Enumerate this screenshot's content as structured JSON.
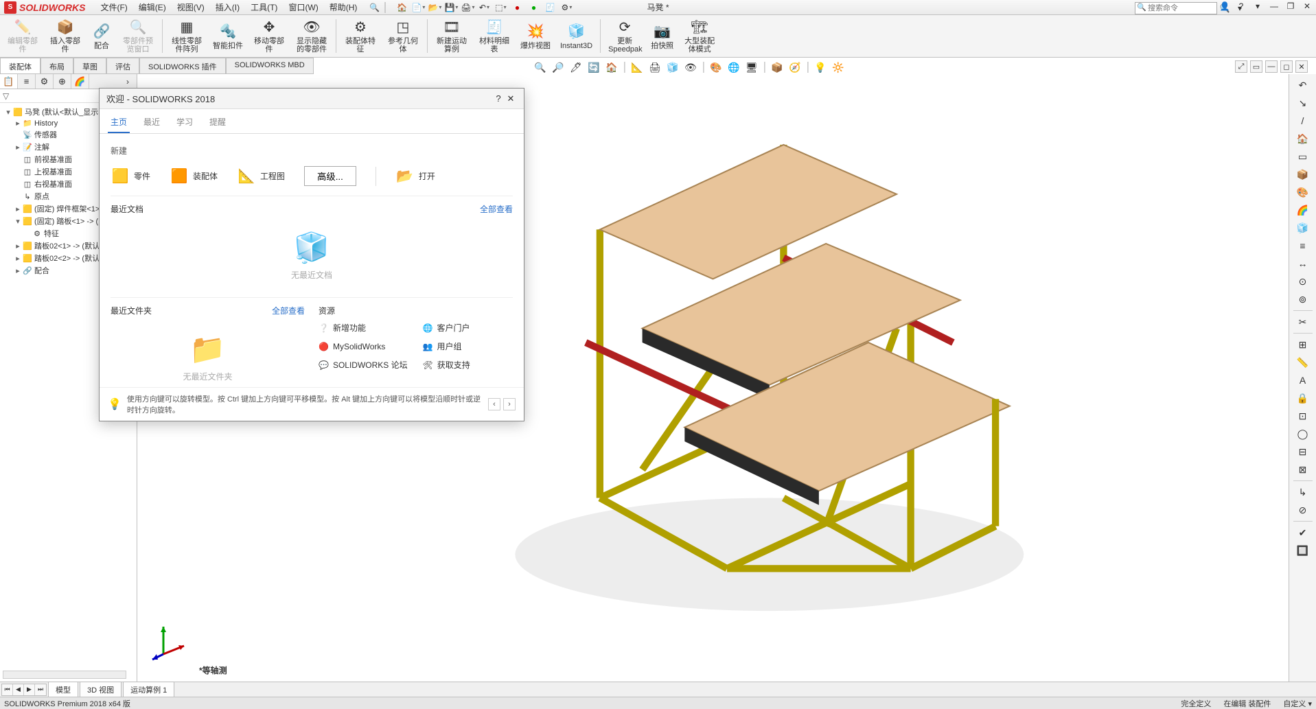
{
  "app": {
    "name": "SOLIDWORKS",
    "doc_title": "马凳 *"
  },
  "menu": [
    "文件(F)",
    "编辑(E)",
    "视图(V)",
    "插入(I)",
    "工具(T)",
    "窗口(W)",
    "帮助(H)"
  ],
  "search": {
    "placeholder": "搜索命令"
  },
  "ribbon": [
    {
      "label": "编辑零部件",
      "icon": "✏️",
      "disabled": true
    },
    {
      "label": "插入零部件",
      "icon": "📦"
    },
    {
      "label": "配合",
      "icon": "🔗"
    },
    {
      "label": "零部件预览窗口",
      "icon": "🔍",
      "disabled": true
    },
    {
      "label": "线性零部件阵列",
      "icon": "▦"
    },
    {
      "label": "智能扣件",
      "icon": "🔩"
    },
    {
      "label": "移动零部件",
      "icon": "✥"
    },
    {
      "label": "显示隐藏的零部件",
      "icon": "👁"
    },
    {
      "label": "装配体特征",
      "icon": "⚙"
    },
    {
      "label": "参考几何体",
      "icon": "◳"
    },
    {
      "label": "新建运动算例",
      "icon": "🎞"
    },
    {
      "label": "材料明细表",
      "icon": "🧾"
    },
    {
      "label": "爆炸视图",
      "icon": "💥"
    },
    {
      "label": "Instant3D",
      "icon": "🧊"
    },
    {
      "label": "更新Speedpak",
      "icon": "⟳"
    },
    {
      "label": "拍快照",
      "icon": "📷"
    },
    {
      "label": "大型装配体模式",
      "icon": "🏗"
    }
  ],
  "feature_tabs": [
    "装配体",
    "布局",
    "草图",
    "评估",
    "SOLIDWORKS 插件",
    "SOLIDWORKS MBD"
  ],
  "feature_tabs_active": 0,
  "hud": [
    "🔍",
    "🔎",
    "🖊",
    "🔄",
    "🏠",
    "📐",
    "🖨",
    "🧊",
    "👁",
    "🎨",
    "🌐",
    "🖥",
    "📦",
    "🧭",
    "💡",
    "🔆"
  ],
  "doc_win": [
    "⤢",
    "▭",
    "—",
    "◻",
    "✕"
  ],
  "fm_tabs": [
    "📋",
    "≡",
    "⚙",
    "⊕",
    "🌈"
  ],
  "fm_root": "马凳  (默认<默认_显示状态-",
  "tree": [
    {
      "lvl": 2,
      "exp": "▸",
      "icon": "📁",
      "label": "History"
    },
    {
      "lvl": 2,
      "exp": "",
      "icon": "📡",
      "label": "传感器"
    },
    {
      "lvl": 2,
      "exp": "▸",
      "icon": "📝",
      "label": "注解"
    },
    {
      "lvl": 2,
      "exp": "",
      "icon": "◫",
      "label": "前视基准面"
    },
    {
      "lvl": 2,
      "exp": "",
      "icon": "◫",
      "label": "上视基准面"
    },
    {
      "lvl": 2,
      "exp": "",
      "icon": "◫",
      "label": "右视基准面"
    },
    {
      "lvl": 2,
      "exp": "",
      "icon": "↳",
      "label": "原点"
    },
    {
      "lvl": 2,
      "exp": "▸",
      "icon": "🟨",
      "label": "(固定) 焊件框架<1> -> ?"
    },
    {
      "lvl": 2,
      "exp": "▾",
      "icon": "🟨",
      "label": "(固定) 踏板<1> -> (默认"
    },
    {
      "lvl": 3,
      "exp": "",
      "icon": "⚙",
      "label": "特征"
    },
    {
      "lvl": 2,
      "exp": "▸",
      "icon": "🟨",
      "label": "踏板02<1> -> (默认<"
    },
    {
      "lvl": 2,
      "exp": "▸",
      "icon": "🟨",
      "label": "踏板02<2> -> (默认<"
    },
    {
      "lvl": 2,
      "exp": "▸",
      "icon": "🔗",
      "label": "配合"
    }
  ],
  "welcome": {
    "title": "欢迎 - SOLIDWORKS 2018",
    "tabs": [
      "主页",
      "最近",
      "学习",
      "提醒"
    ],
    "active_tab": 0,
    "new_label": "新建",
    "new_items": [
      {
        "icon": "🟨",
        "label": "零件"
      },
      {
        "icon": "🟧",
        "label": "装配体"
      },
      {
        "icon": "📐",
        "label": "工程图"
      }
    ],
    "advanced": "高级...",
    "open_label": "打开",
    "recent_docs": {
      "title": "最近文档",
      "view_all": "全部查看",
      "empty": "无最近文档"
    },
    "recent_folders": {
      "title": "最近文件夹",
      "view_all": "全部查看",
      "empty": "无最近文件夹"
    },
    "resources_title": "资源",
    "resources": [
      {
        "icon": "❔",
        "label": "新增功能"
      },
      {
        "icon": "🌐",
        "label": "客户门户"
      },
      {
        "icon": "🔴",
        "label": "MySolidWorks"
      },
      {
        "icon": "👥",
        "label": "用户组"
      },
      {
        "icon": "💬",
        "label": "SOLIDWORKS 论坛"
      },
      {
        "icon": "🛠",
        "label": "获取支持"
      }
    ],
    "tip": "使用方向键可以旋转模型。按 Ctrl 键加上方向键可平移模型。按 Alt 键加上方向键可以将模型沿顺时针或逆时针方向旋转。"
  },
  "right_toolbar": [
    "↶",
    "↘",
    "/",
    "🏠",
    "▭",
    "📦",
    "🎨",
    "🌈",
    "🧊",
    "≡",
    "↔",
    "⊙",
    "⊚",
    "—",
    "✂",
    "—",
    "⊞",
    "📏",
    "A",
    "🔒",
    "⊡",
    "◯",
    "⊟",
    "⊠",
    "—",
    "↳",
    "⊘",
    "—",
    "✔",
    "🔲"
  ],
  "orientation": "*等轴测",
  "bottom_nav": [
    "⏮",
    "◀",
    "▶",
    "⏭"
  ],
  "bottom_tabs": [
    "模型",
    "3D 视图",
    "运动算例 1"
  ],
  "bottom_active": 0,
  "status": {
    "left": "SOLIDWORKS Premium 2018 x64 版",
    "right": [
      "完全定义",
      "在编辑 装配件",
      "自定义 ▾"
    ]
  }
}
